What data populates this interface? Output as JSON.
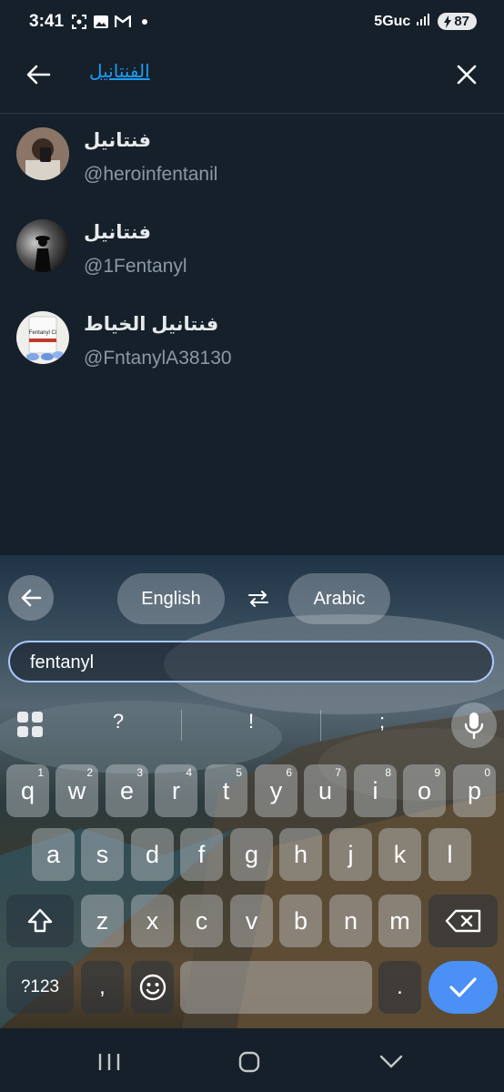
{
  "status": {
    "time": "3:41",
    "network": "5Guc",
    "battery": "87",
    "left_icons": [
      "screenshot-icon",
      "photo-icon",
      "gmail-icon",
      "dot-icon"
    ]
  },
  "search": {
    "query": "الفنتانيل",
    "back_icon": "arrow-left-icon",
    "clear_icon": "close-icon"
  },
  "results": [
    {
      "name": "فنتانيل",
      "handle": "@heroinfentanil"
    },
    {
      "name": "فنتانيل",
      "handle": "@1Fentanyl"
    },
    {
      "name": "فنتانيل الخياط",
      "handle": "@FntanylA38130",
      "avatar_text": "Fentanyl Ci"
    }
  ],
  "translate": {
    "source_lang": "English",
    "target_lang": "Arabic",
    "input": "fentanyl"
  },
  "suggestions": [
    "?",
    "!",
    ";"
  ],
  "keyboard": {
    "row1": [
      {
        "k": "q",
        "h": "1"
      },
      {
        "k": "w",
        "h": "2"
      },
      {
        "k": "e",
        "h": "3"
      },
      {
        "k": "r",
        "h": "4"
      },
      {
        "k": "t",
        "h": "5"
      },
      {
        "k": "y",
        "h": "6"
      },
      {
        "k": "u",
        "h": "7"
      },
      {
        "k": "i",
        "h": "8"
      },
      {
        "k": "o",
        "h": "9"
      },
      {
        "k": "p",
        "h": "0"
      }
    ],
    "row2": [
      "a",
      "s",
      "d",
      "f",
      "g",
      "h",
      "j",
      "k",
      "l"
    ],
    "row3": [
      "z",
      "x",
      "c",
      "v",
      "b",
      "n",
      "m"
    ],
    "symbols_label": "?123",
    "comma": ",",
    "period": "."
  },
  "colors": {
    "background": "#15202b",
    "accent": "#1d9bf0",
    "enter_key": "#4a90f5"
  }
}
